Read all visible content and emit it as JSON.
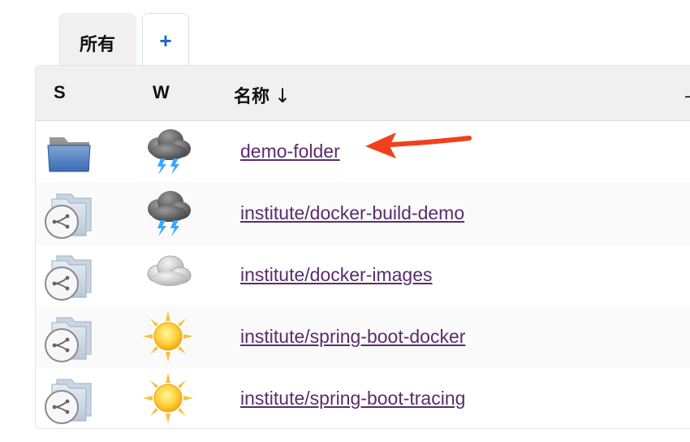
{
  "tabs": {
    "all_label": "所有",
    "add_label": "+"
  },
  "table": {
    "headers": {
      "status": "S",
      "weather": "W",
      "name": "名称",
      "sort_indicator": "↓",
      "partial_next": "⅃"
    },
    "rows": [
      {
        "status_icon": "folder-icon",
        "weather_icon": "storm-cloud-icon",
        "name": "demo-folder"
      },
      {
        "status_icon": "multibranch-folder-icon",
        "weather_icon": "storm-cloud-icon",
        "name": "institute/docker-build-demo"
      },
      {
        "status_icon": "multibranch-folder-icon",
        "weather_icon": "cloudy-icon",
        "name": "institute/docker-images"
      },
      {
        "status_icon": "multibranch-folder-icon",
        "weather_icon": "sunny-icon",
        "name": "institute/spring-boot-docker"
      },
      {
        "status_icon": "multibranch-folder-icon",
        "weather_icon": "sunny-icon",
        "name": "institute/spring-boot-tracing"
      }
    ]
  },
  "colors": {
    "link": "#5a2d6b",
    "annotation_arrow": "#f0401c",
    "add_tab_plus": "#1f63c8",
    "header_bg": "#f0f0f0"
  }
}
